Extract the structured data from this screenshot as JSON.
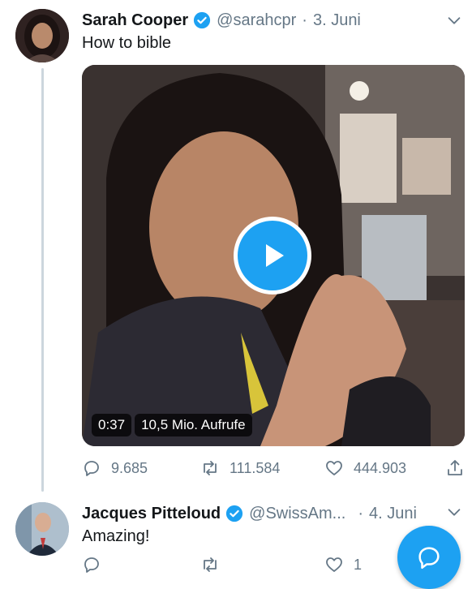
{
  "tweets": [
    {
      "display_name": "Sarah Cooper",
      "handle": "@sarahcpr",
      "separator": "·",
      "date": "3. Juni",
      "text": "How to bible",
      "media": {
        "duration": "0:37",
        "views": "10,5 Mio. Aufrufe"
      },
      "stats": {
        "replies": "9.685",
        "retweets": "111.584",
        "likes": "444.903"
      }
    },
    {
      "display_name": "Jacques Pitteloud",
      "handle": "@SwissAm...",
      "separator": "·",
      "date": "4. Juni",
      "text": "Amazing!",
      "stats": {
        "replies": "",
        "retweets": "",
        "likes": "1"
      }
    }
  ],
  "colors": {
    "accent": "#1da1f2",
    "muted": "#657786",
    "text": "#14171a",
    "thread_line": "#ccd6dd"
  },
  "icons": {
    "verified": "verified-badge-icon",
    "menu": "chevron-down-icon",
    "reply": "reply-icon",
    "retweet": "retweet-icon",
    "like": "heart-icon",
    "share": "share-icon",
    "play": "play-icon",
    "compose": "compose-reply-icon"
  }
}
